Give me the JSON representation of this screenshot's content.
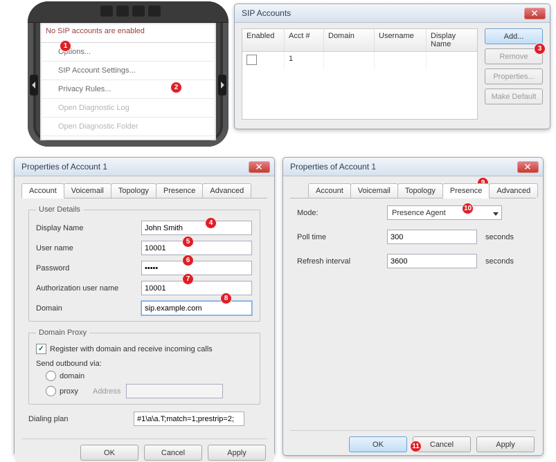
{
  "phone": {
    "status": "No SIP accounts are enabled",
    "menu": [
      "Options...",
      "SIP Account Settings...",
      "Privacy Rules...",
      "Open Diagnostic Log",
      "Open Diagnostic Folder"
    ]
  },
  "callouts": [
    "1",
    "2",
    "3",
    "4",
    "5",
    "6",
    "7",
    "8",
    "9",
    "10",
    "11"
  ],
  "sip": {
    "title": "SIP Accounts",
    "cols": [
      "Enabled",
      "Acct #",
      "Domain",
      "Username",
      "Display Name"
    ],
    "row": {
      "acct": "1",
      "domain": "",
      "username": "",
      "display": ""
    },
    "btns": {
      "add": "Add...",
      "remove": "Remove",
      "properties": "Properties...",
      "default": "Make Default"
    }
  },
  "propA": {
    "title": "Properties of Account 1",
    "tabs": [
      "Account",
      "Voicemail",
      "Topology",
      "Presence",
      "Advanced"
    ],
    "user_leg": "User Details",
    "labels": {
      "display": "Display Name",
      "user": "User name",
      "pass": "Password",
      "auth": "Authorization user name",
      "domain": "Domain"
    },
    "vals": {
      "display": "John Smith",
      "user": "10001",
      "pass": "•••••",
      "auth": "10001",
      "domain": "sip.example.com"
    },
    "proxy_leg": "Domain Proxy",
    "proxy": {
      "reg": "Register with domain and receive incoming calls",
      "send": "Send outbound via:",
      "domain": "domain",
      "proxy": "proxy",
      "addr": "Address"
    },
    "dial_lbl": "Dialing plan",
    "dial": "#1\\a\\a.T;match=1;prestrip=2;",
    "ok": "OK",
    "cancel": "Cancel",
    "apply": "Apply"
  },
  "propB": {
    "title": "Properties of Account 1",
    "mode_lbl": "Mode:",
    "mode": "Presence Agent",
    "poll_lbl": "Poll time",
    "poll": "300",
    "refresh_lbl": "Refresh interval",
    "refresh": "3600",
    "seconds": "seconds",
    "ok": "OK",
    "cancel": "Cancel",
    "apply": "Apply"
  }
}
